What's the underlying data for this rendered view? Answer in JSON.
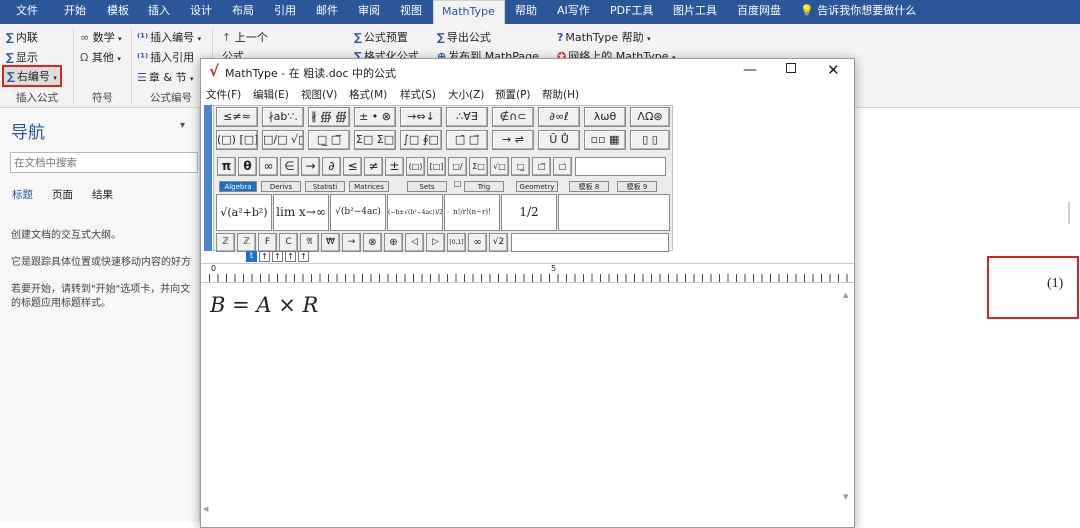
{
  "ribbon": {
    "tabs": [
      "文件",
      "开始",
      "模板",
      "插入",
      "设计",
      "布局",
      "引用",
      "邮件",
      "审阅",
      "视图",
      "MathType",
      "帮助",
      "AI写作",
      "PDF工具",
      "图片工具",
      "百度网盘"
    ],
    "active_tab": "MathType",
    "tell_me": "告诉我你想要做什么",
    "groups": {
      "insert_eq": {
        "inline": "内联",
        "display": "显示",
        "right_num": "右编号",
        "label": "插入公式"
      },
      "symbols": {
        "math": "数学",
        "other": "其他",
        "label": "符号"
      },
      "eq_num": {
        "insert_num": "插入编号",
        "insert_ref": "插入引用",
        "chapter": "章 & 节",
        "label": "公式编号"
      },
      "browse": {
        "prev": "上一个",
        "eq": "公式"
      },
      "presets": {
        "eq_preset": "公式预置",
        "format": "格式化公式"
      },
      "export": {
        "export": "导出公式",
        "publish": "发布到 MathPage"
      },
      "help": {
        "help": "MathType 帮助",
        "online": "网络上的 MathType"
      }
    }
  },
  "nav": {
    "title": "导航",
    "search_placeholder": "在文档中搜索",
    "tabs": [
      "标题",
      "页面",
      "结果"
    ],
    "p1": "创建文档的交互式大纲。",
    "p2": "它是跟踪具体位置或快速移动内容的好方",
    "p3a": "若要开始，请转到\"开始\"选项卡，并向文",
    "p3b": "的标题应用标题样式。"
  },
  "doc": {
    "eq_number": "(1)"
  },
  "mathtype": {
    "title": "MathType - 在 粗读.doc 中的公式",
    "menu": [
      "文件(F)",
      "编辑(E)",
      "视图(V)",
      "格式(M)",
      "样式(S)",
      "大小(Z)",
      "预置(P)",
      "帮助(H)"
    ],
    "palette_row1": [
      "≤≠≈",
      "∤ab∵.",
      "∦ ∰ ∰",
      "± • ⊗",
      "→⇔↓",
      "∴∀∃",
      "∉∩⊂",
      "∂∞ℓ",
      "λωθ",
      "ΛΩ⊛"
    ],
    "palette_row2": [
      "(□) [□]",
      "□/□ √□",
      "□̲ □̅",
      "Σ□ Σ□",
      "∫□ ∮□",
      "□̄ □⃗",
      "→ ⇌",
      "Ū Ů",
      "▫▫ ▦",
      "▯ ▯"
    ],
    "small_row": [
      "π",
      "θ",
      "∞",
      "∈",
      "→",
      "∂",
      "≤",
      "≠",
      "±",
      "(□)",
      "[□]",
      "□/□",
      "Σ□",
      "√□",
      "□̲",
      "□̅",
      "□̇"
    ],
    "tabs": [
      "Algebra",
      "Derivs",
      "Statisti",
      "Matrices",
      "Sets",
      "Trig",
      "Geometry",
      "模板 8",
      "模板 9"
    ],
    "templates": [
      "√(a²+b²)",
      "lim x→∞",
      "√(b²−4ac)",
      "(−b±√(b²−4ac))/2a",
      "n!/r!(n−r)!",
      "1/2"
    ],
    "bottom_row": [
      "ℤ",
      "ℤ",
      "F",
      "C",
      "𝔄",
      "₩",
      "→",
      "⊗",
      "⊕",
      "◁",
      "▷",
      "[0,1]",
      "∞",
      "√2"
    ],
    "tab_stops": [
      "t",
      "↑",
      "↑",
      "↑",
      "↑"
    ],
    "ruler": [
      "0",
      "5"
    ],
    "equation": "B = A × R"
  }
}
